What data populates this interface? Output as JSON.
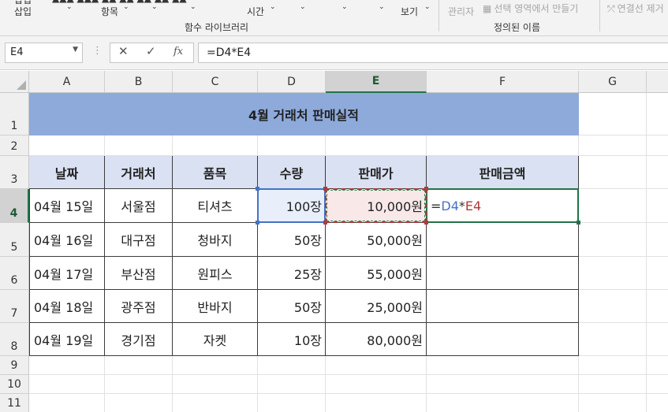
{
  "ribbon": {
    "insert_label": "삽입",
    "items_label": "항목",
    "time_label": "시간",
    "view_label": "보기",
    "manager_label": "관리자",
    "create_from_selection_label": "선택 영역에서 만들기",
    "remove_arrows_label": "연결선 제거",
    "function_library_group": "함수 라이브러리",
    "defined_names_group": "정의된 이름"
  },
  "formula_bar": {
    "name_box": "E4",
    "function_icon": "fx",
    "formula": "=D4*E4"
  },
  "columns": [
    "A",
    "B",
    "C",
    "D",
    "E",
    "F",
    "G"
  ],
  "rows": [
    "1",
    "2",
    "3",
    "4",
    "5",
    "6",
    "7",
    "8",
    "9",
    "10",
    "11"
  ],
  "table": {
    "title": "4월 거래처 판매실적",
    "headers": [
      "날짜",
      "거래처",
      "품목",
      "수량",
      "판매가",
      "판매금액"
    ],
    "rows": [
      [
        "04월 15일",
        "서울점",
        "티셔츠",
        "100장",
        "10,000원"
      ],
      [
        "04월 16일",
        "대구점",
        "청바지",
        "50장",
        "50,000원"
      ],
      [
        "04월 17일",
        "부산점",
        "원피스",
        "25장",
        "55,000원"
      ],
      [
        "04월 18일",
        "광주점",
        "반바지",
        "50장",
        "25,000원"
      ],
      [
        "04월 19일",
        "경기점",
        "자켓",
        "10장",
        "80,000원"
      ]
    ]
  },
  "active_cell_formula": {
    "eq": "=",
    "ref1": "D4",
    "op": "*",
    "ref2": "E4"
  },
  "colors": {
    "title_fill": "#8eaadb",
    "header_fill": "#d9e1f2",
    "active_green": "#217346",
    "ref_blue": "#4472c4",
    "ref_red": "#b03a3a"
  }
}
